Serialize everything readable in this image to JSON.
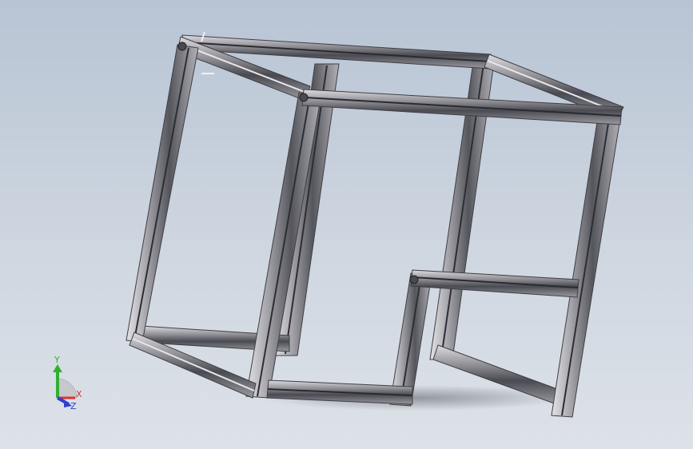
{
  "viewport": {
    "background_top": "#b8c4d4",
    "background_bottom": "#dde2e8"
  },
  "model": {
    "frame_color": "#8c8c90",
    "frame_dark": "#3e3e44",
    "frame_light": "#d2d2d6"
  },
  "triad": {
    "x_label": "X",
    "y_label": "Y",
    "z_label": "Z",
    "x_color": "#e03030",
    "y_color": "#30b030",
    "z_color": "#3040d0"
  }
}
